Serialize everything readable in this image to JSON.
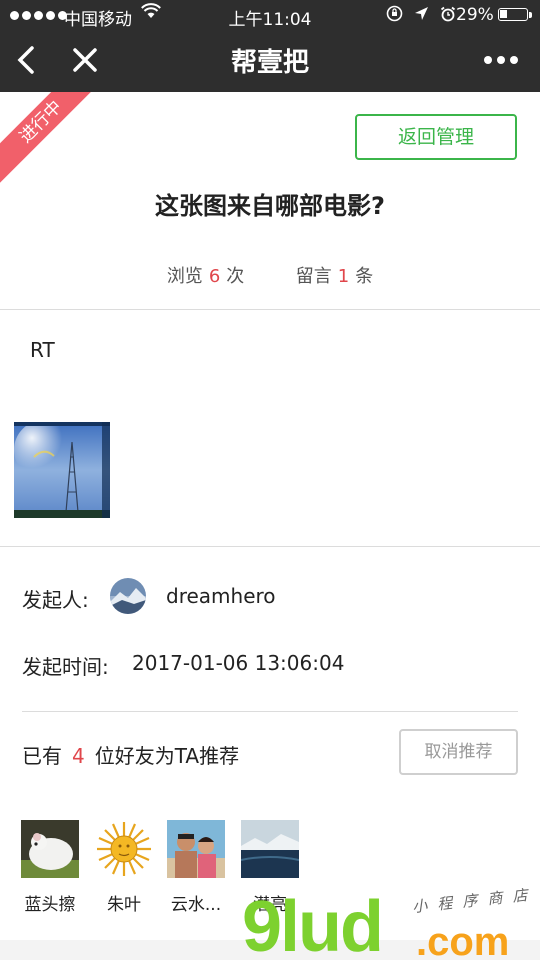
{
  "status_bar": {
    "carrier": "中国移动",
    "time": "上午11:04",
    "battery_percent": "29%",
    "battery_level": 0.29,
    "icons": [
      "signal-dots-icon",
      "wifi-icon",
      "screen-lock-icon",
      "location-icon",
      "alarm-icon",
      "battery-icon"
    ]
  },
  "nav": {
    "title": "帮壹把",
    "icons": [
      "back-icon",
      "close-icon",
      "more-icon"
    ]
  },
  "ribbon": {
    "label": "进行中",
    "color": "#f1606a"
  },
  "manage_button": {
    "label": "返回管理",
    "color": "#3bb54a"
  },
  "question": {
    "title": "这张图来自哪部电影?",
    "views_label": "浏览",
    "views": "6",
    "views_unit": "次",
    "comments_label": "留言",
    "comments": "1",
    "comments_unit": "条",
    "accent": "#e0464b"
  },
  "content": {
    "text": "RT"
  },
  "initiator": {
    "label": "发起人:",
    "name": "dreamhero",
    "time_label": "发起时间:",
    "time": "2017-01-06 13:06:04"
  },
  "recommend": {
    "prefix": "已有",
    "count": "4",
    "suffix": "位好友为TA推荐",
    "cancel_label": "取消推荐"
  },
  "friends": [
    {
      "name": "蓝头擦"
    },
    {
      "name": "朱叶"
    },
    {
      "name": "云水..."
    },
    {
      "name": "潜亮"
    }
  ],
  "watermark": {
    "main": "9lud",
    "dot": ".com",
    "sub": "小 程 序 商 店"
  }
}
